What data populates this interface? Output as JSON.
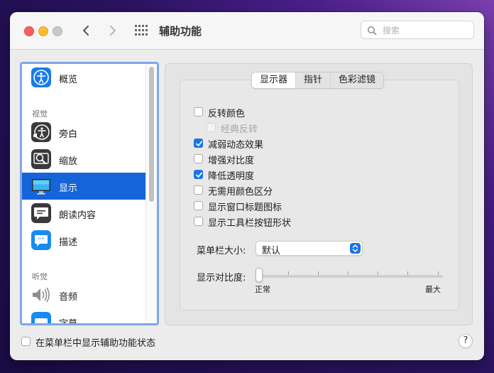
{
  "window": {
    "title": "辅助功能"
  },
  "search": {
    "placeholder": "搜索"
  },
  "sidebar": {
    "items": [
      {
        "label": "概览",
        "icon": "accessibility-icon"
      },
      {
        "label": "旁白",
        "icon": "voiceover-icon"
      },
      {
        "label": "缩放",
        "icon": "zoom-icon"
      },
      {
        "label": "显示",
        "icon": "display-icon",
        "selected": true
      },
      {
        "label": "朗读内容",
        "icon": "speech-icon"
      },
      {
        "label": "描述",
        "icon": "descriptions-icon"
      },
      {
        "label": "音频",
        "icon": "speaker-icon"
      },
      {
        "label": "字幕",
        "icon": "captions-icon"
      }
    ],
    "sections": {
      "vision": "视觉",
      "hearing": "听觉"
    }
  },
  "tabs": [
    {
      "label": "显示器",
      "active": true
    },
    {
      "label": "指针",
      "active": false
    },
    {
      "label": "色彩滤镜",
      "active": false
    }
  ],
  "options": [
    {
      "label": "反转颜色",
      "checked": false,
      "enabled": true
    },
    {
      "label": "经典反转",
      "checked": false,
      "enabled": false
    },
    {
      "label": "减弱动态效果",
      "checked": true,
      "enabled": true
    },
    {
      "label": "增强对比度",
      "checked": false,
      "enabled": true
    },
    {
      "label": "降低透明度",
      "checked": true,
      "enabled": true
    },
    {
      "label": "无需用颜色区分",
      "checked": false,
      "enabled": true
    },
    {
      "label": "显示窗口标题图标",
      "checked": false,
      "enabled": true
    },
    {
      "label": "显示工具栏按钮形状",
      "checked": false,
      "enabled": true
    }
  ],
  "menu_bar_size": {
    "label": "菜单栏大小:",
    "value": "默认"
  },
  "contrast": {
    "label": "显示对比度:",
    "min_label": "正常",
    "max_label": "最大",
    "value": 0
  },
  "footer": {
    "show_status_label": "在菜单栏中显示辅助功能状态",
    "show_status_checked": false,
    "help": "?"
  },
  "colors": {
    "accent": "#1b73e8",
    "selection": "#1664d9"
  }
}
